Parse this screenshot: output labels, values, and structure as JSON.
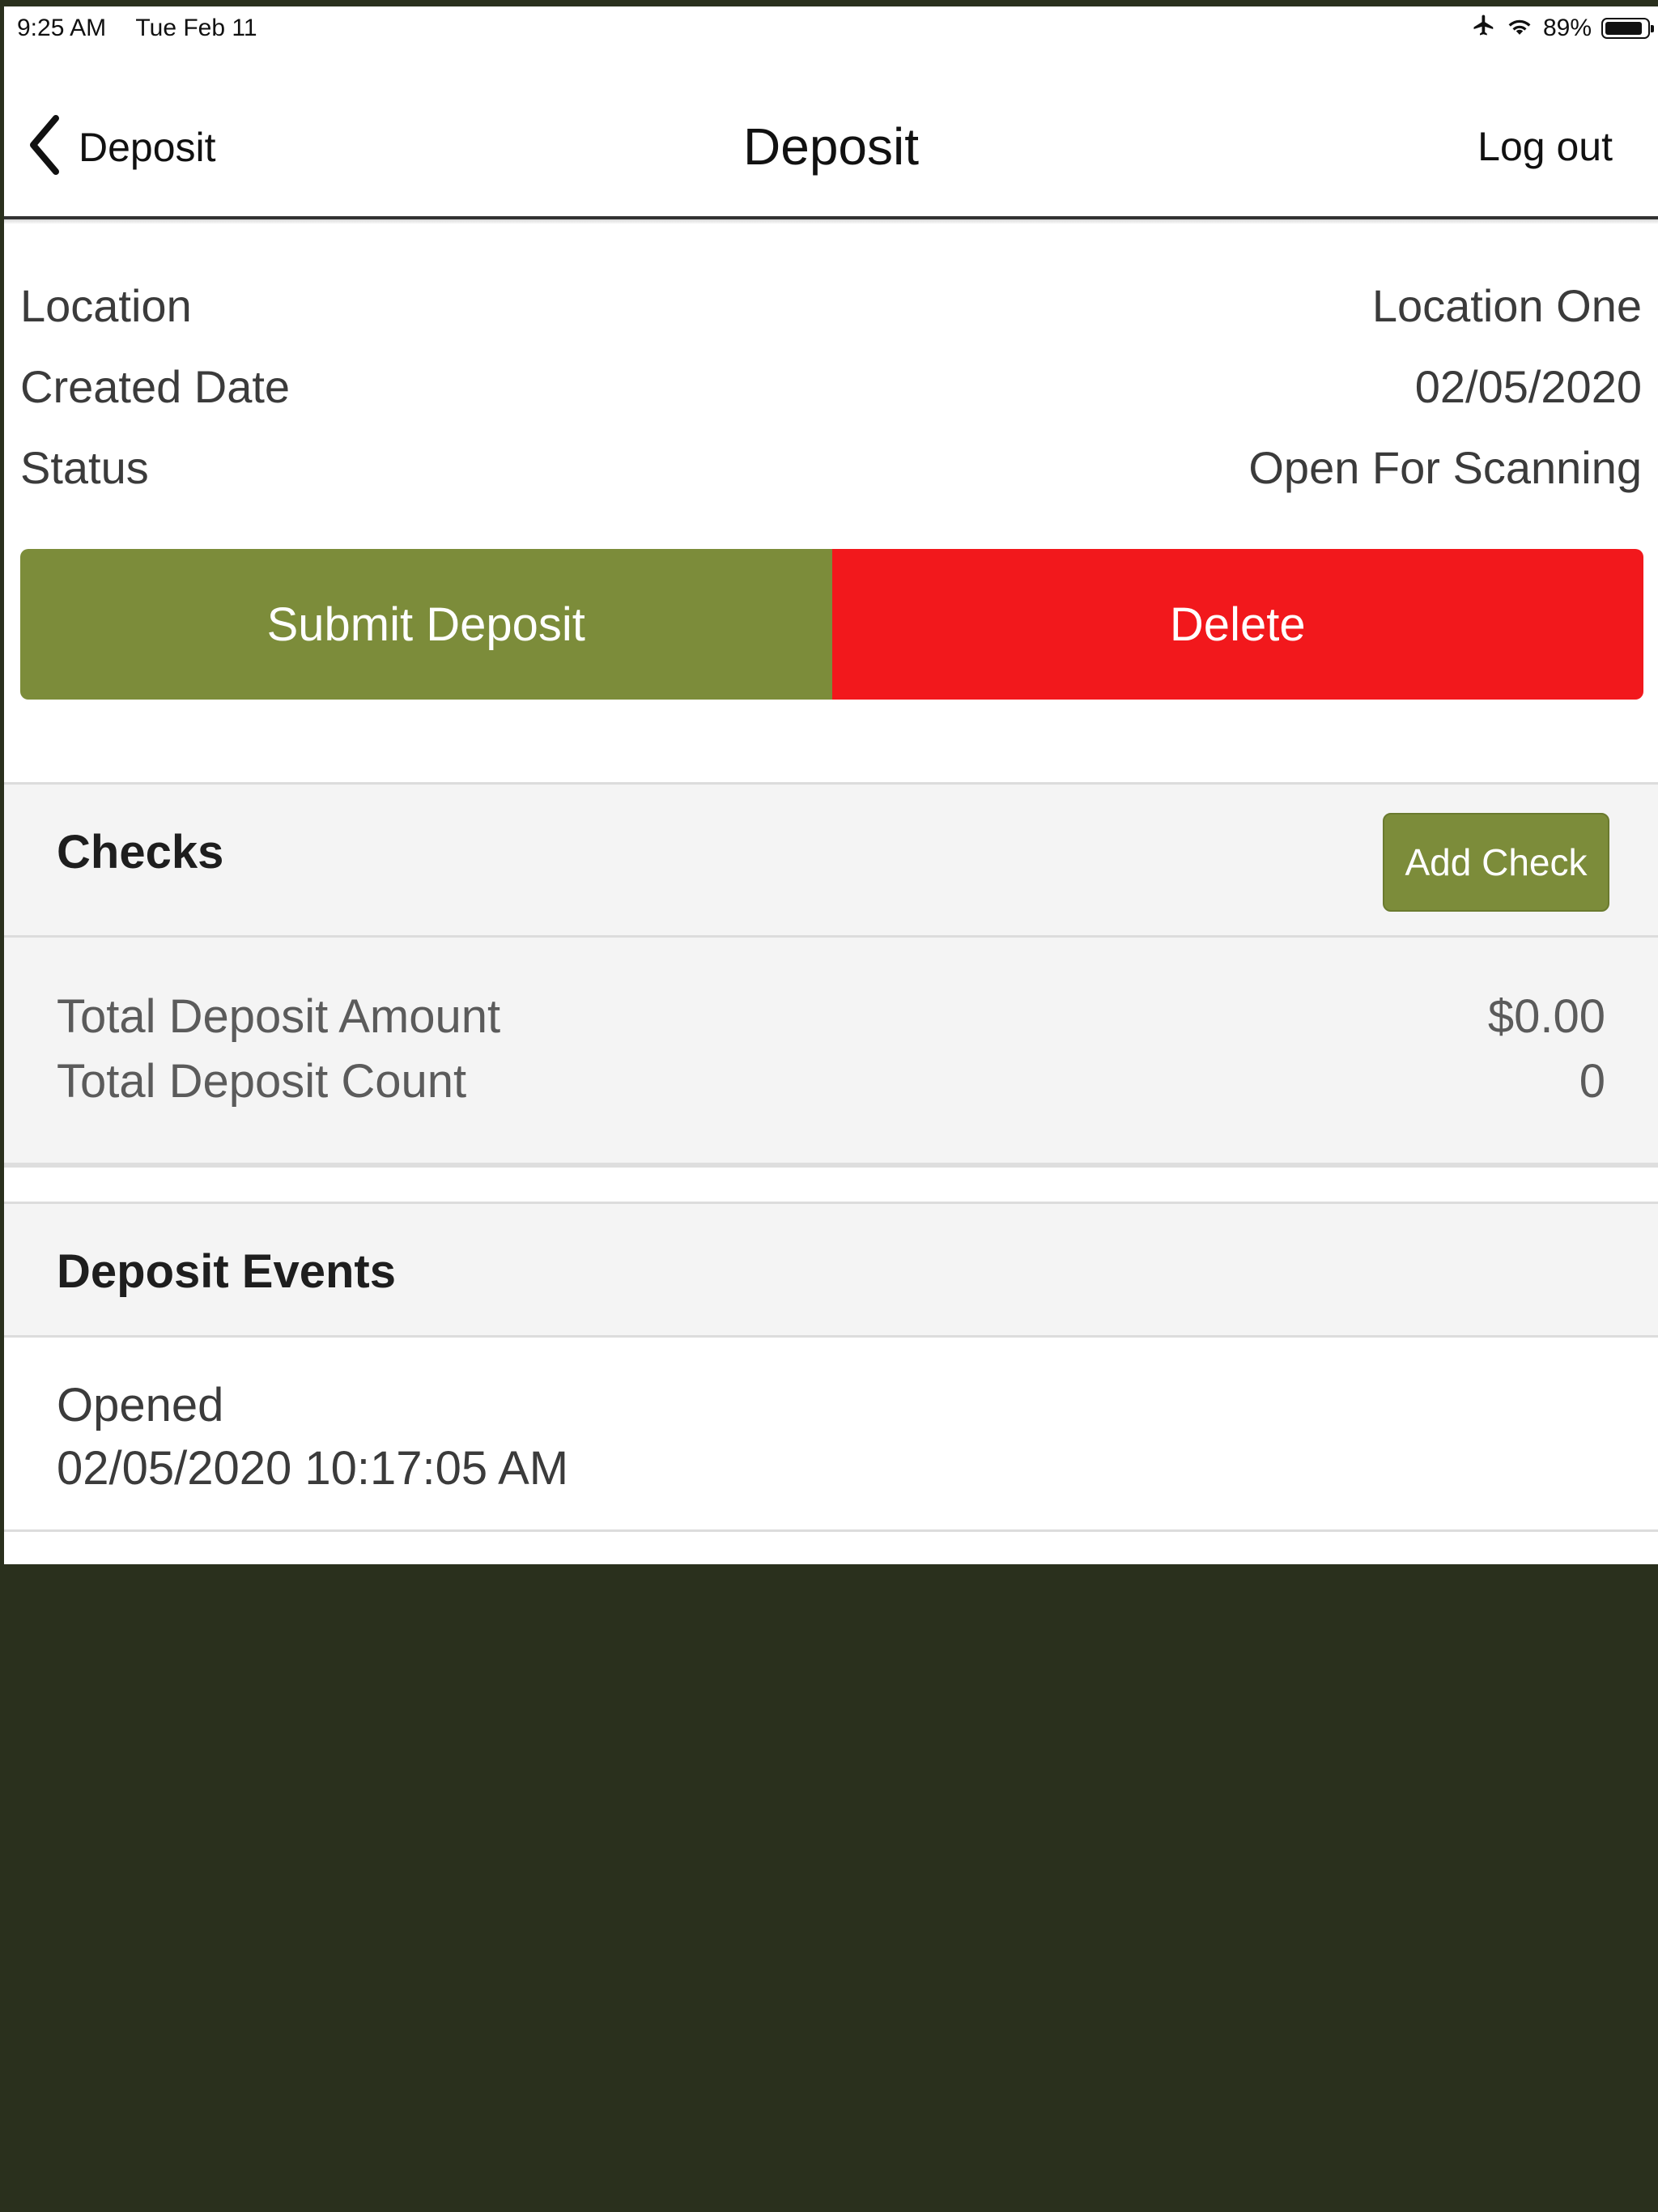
{
  "status_bar": {
    "time": "9:25 AM",
    "date": "Tue Feb 11",
    "battery": "89%",
    "battery_level": 0.89,
    "icons": [
      "airplane-icon",
      "wifi-icon",
      "battery-icon"
    ]
  },
  "nav": {
    "back_label": "Deposit",
    "title": "Deposit",
    "logout_label": "Log out"
  },
  "info": [
    {
      "label": "Location",
      "value": "Location One"
    },
    {
      "label": "Created Date",
      "value": "02/05/2020"
    },
    {
      "label": "Status",
      "value": "Open For Scanning"
    }
  ],
  "actions": {
    "submit_label": "Submit Deposit",
    "delete_label": "Delete"
  },
  "checks": {
    "title": "Checks",
    "add_label": "Add Check",
    "total_amount_label": "Total Deposit Amount",
    "total_amount_value": "$0.00",
    "total_count_label": "Total Deposit Count",
    "total_count_value": "0"
  },
  "events": {
    "title": "Deposit Events",
    "items": [
      {
        "name": "Opened",
        "time": "02/05/2020 10:17:05 AM"
      }
    ]
  },
  "colors": {
    "accent_green": "#7c8c3a",
    "delete_red": "#f2181c",
    "background_dark": "#2a301d"
  }
}
